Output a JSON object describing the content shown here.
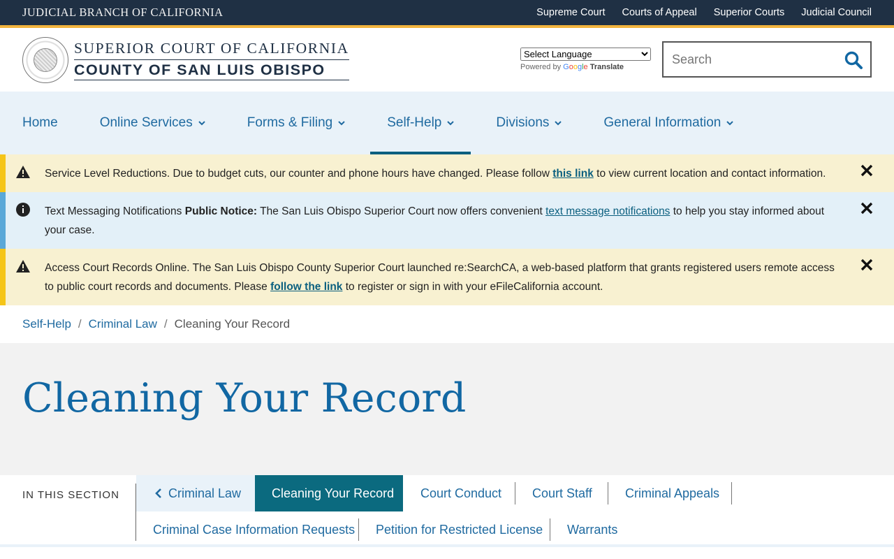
{
  "topbar": {
    "brand": "JUDICIAL BRANCH OF CALIFORNIA",
    "links": [
      "Supreme Court",
      "Courts of Appeal",
      "Superior Courts",
      "Judicial Council"
    ]
  },
  "header": {
    "line1": "SUPERIOR COURT OF CALIFORNIA",
    "line2": "COUNTY OF SAN LUIS OBISPO",
    "language_select": "Select Language",
    "powered_by": "Powered by",
    "google": "Google",
    "translate": "Translate",
    "search_placeholder": "Search"
  },
  "nav": {
    "items": [
      {
        "label": "Home",
        "dropdown": false
      },
      {
        "label": "Online Services",
        "dropdown": true
      },
      {
        "label": "Forms & Filing",
        "dropdown": true
      },
      {
        "label": "Self-Help",
        "dropdown": true,
        "active": true
      },
      {
        "label": "Divisions",
        "dropdown": true
      },
      {
        "label": "General Information",
        "dropdown": true
      }
    ]
  },
  "alerts": [
    {
      "type": "warning",
      "before": "Service Level Reductions. Due to budget cuts, our counter and phone hours have changed. Please follow ",
      "link": "this link",
      "after": " to view current location and contact information."
    },
    {
      "type": "info",
      "title": "Text Messaging Notifications ",
      "bold": "Public Notice:",
      "before": " The San Luis Obispo Superior Court now offers convenient ",
      "link": "text message notifications",
      "after": " to help you stay informed about your case."
    },
    {
      "type": "warning",
      "before": "Access Court Records Online. The San Luis Obispo County Superior Court launched re:SearchCA, a web-based platform that grants registered users remote access to public court records and documents. Please ",
      "link": "follow the link",
      "after": " to register or sign in with your eFileCalifornia account."
    }
  ],
  "breadcrumb": {
    "items": [
      "Self-Help",
      "Criminal Law"
    ],
    "separator": "/",
    "current": "Cleaning Your Record"
  },
  "page": {
    "title": "Cleaning Your Record"
  },
  "section_nav": {
    "label": "IN THIS SECTION",
    "back": "Criminal Law",
    "tabs": [
      "Cleaning Your Record",
      "Court Conduct",
      "Court Staff",
      "Criminal Appeals",
      "Criminal Case Information Requests",
      "Petition for Restricted License",
      "Warrants"
    ]
  },
  "colors": {
    "topbar": "#1f3044",
    "gold": "#f2b33d",
    "nav_bg": "#e9f2f9",
    "link": "#1f6aa0",
    "active_tab": "#0b6a7f",
    "warning_bg": "#f8f1d1",
    "info_bg": "#e3f0f8"
  }
}
